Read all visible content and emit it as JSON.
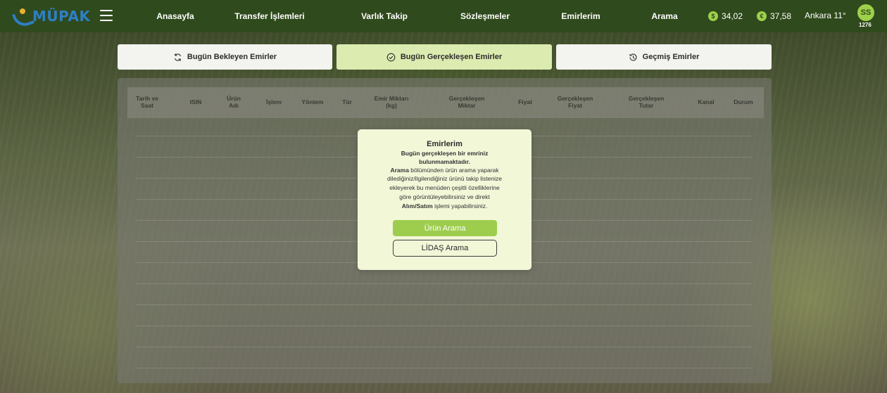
{
  "brand": {
    "name": "MÜPAK"
  },
  "nav": {
    "links": [
      "Anasayfa",
      "Transfer İşlemleri",
      "Varlık Takip",
      "Sözleşmeler",
      "Emirlerim",
      "Arama"
    ],
    "usd_icon": "$",
    "usd_rate": "34,02",
    "eur_icon": "€",
    "eur_rate": "37,58",
    "weather": "Ankara 11°",
    "avatar_initials": "SS",
    "account_number": "1276"
  },
  "tabs": [
    {
      "label": "Bugün Bekleyen Emirler",
      "icon": "refresh-icon",
      "active": false
    },
    {
      "label": "Bugün Gerçekleşen Emirler",
      "icon": "check-circle-icon",
      "active": true
    },
    {
      "label": "Geçmiş Emirler",
      "icon": "history-icon",
      "active": false
    }
  ],
  "table": {
    "headers": [
      [
        "Tarih ve",
        "Saat"
      ],
      [
        "ISIN"
      ],
      [
        "Ürün",
        "Adı"
      ],
      [
        "İşlem"
      ],
      [
        "Yöntem"
      ],
      [
        "Tür"
      ],
      [
        "Emir Miktarı",
        "(kg)"
      ],
      [
        "Gerçekleşen",
        "Miktar"
      ],
      [
        "Fiyat"
      ],
      [
        "Gerçekleşen",
        "Fiyat"
      ],
      [
        "Gerçekleşen",
        "Tutar"
      ],
      [
        "Kanal"
      ],
      [
        "Durum"
      ]
    ]
  },
  "modal": {
    "title": "Emirlerim",
    "message_line1": "Bugün gerçekleşen bir emriniz",
    "message_line2": "bulunmamaktadır.",
    "info_bold1": "Arama",
    "info_line1": " bölümünden ürün arama yaparak",
    "info_line2": "dilediğiniz/ilgilendiğiniz ürünü takip listenize",
    "info_line3": "ekleyerek bu menüden çeşitli özelliklerine",
    "info_line4": "göre görüntüleyebilirsiniz ve direkt",
    "info_bold2": "Alım/Satım",
    "info_line5": " işlemi yapabilirsiniz.",
    "primary_button": "Ürün Arama",
    "secondary_button": "LİDAŞ Arama"
  }
}
